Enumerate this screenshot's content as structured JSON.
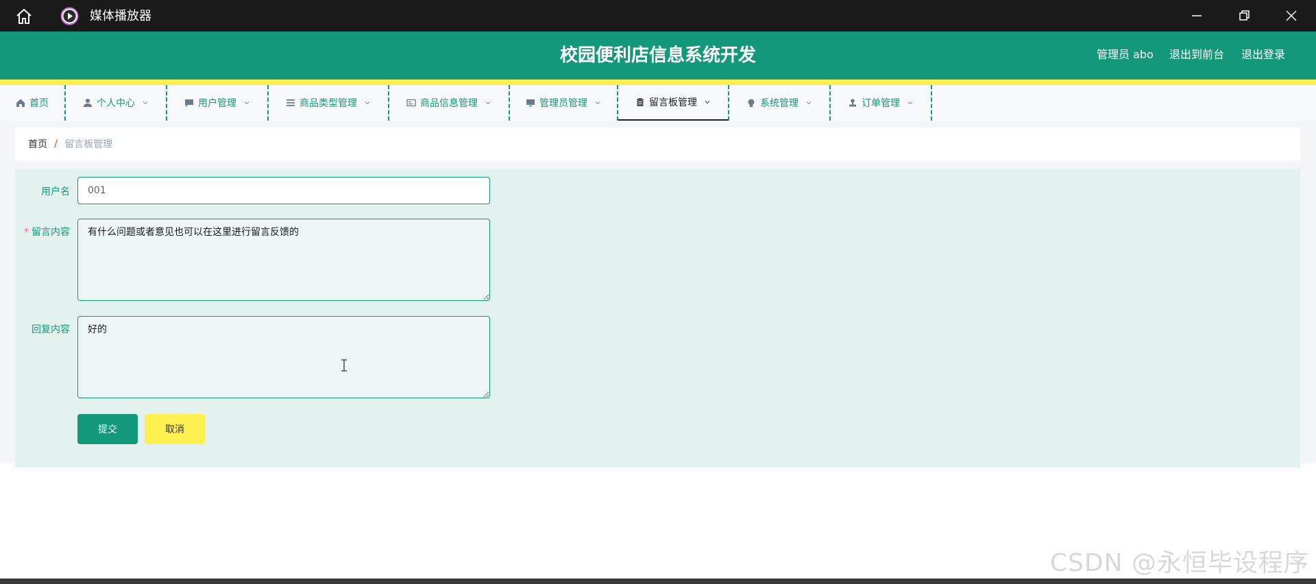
{
  "window": {
    "app_title": "媒体播放器"
  },
  "header": {
    "system_title": "校园便利店信息系统开发",
    "admin_label": "管理员 abo",
    "exit_frontend": "退出到前台",
    "logout": "退出登录"
  },
  "nav": {
    "items": [
      {
        "label": "首页",
        "icon": "home-icon"
      },
      {
        "label": "个人中心",
        "icon": "user-icon"
      },
      {
        "label": "用户管理",
        "icon": "chat-icon"
      },
      {
        "label": "商品类型管理",
        "icon": "list-icon"
      },
      {
        "label": "商品信息管理",
        "icon": "card-icon"
      },
      {
        "label": "管理员管理",
        "icon": "monitor-icon"
      },
      {
        "label": "留言板管理",
        "icon": "clipboard-icon"
      },
      {
        "label": "系统管理",
        "icon": "bulb-icon"
      },
      {
        "label": "订单管理",
        "icon": "stamp-icon"
      }
    ],
    "active": "留言板管理"
  },
  "breadcrumb": {
    "home": "首页",
    "separator": "/",
    "current": "留言板管理"
  },
  "form": {
    "username_label": "用户名",
    "username_value": "001",
    "message_label": "留言内容",
    "message_required_mark": "*",
    "message_value": "有什么问题或者意见也可以在这里进行留言反馈的",
    "reply_label": "回复内容",
    "reply_value": "好的",
    "submit_label": "提交",
    "cancel_label": "取消"
  },
  "watermark": "CSDN @永恒毕设程序",
  "colors": {
    "primary": "#13997a",
    "accent_yellow": "#fdf050",
    "panel_bg": "#e4f2ef"
  }
}
